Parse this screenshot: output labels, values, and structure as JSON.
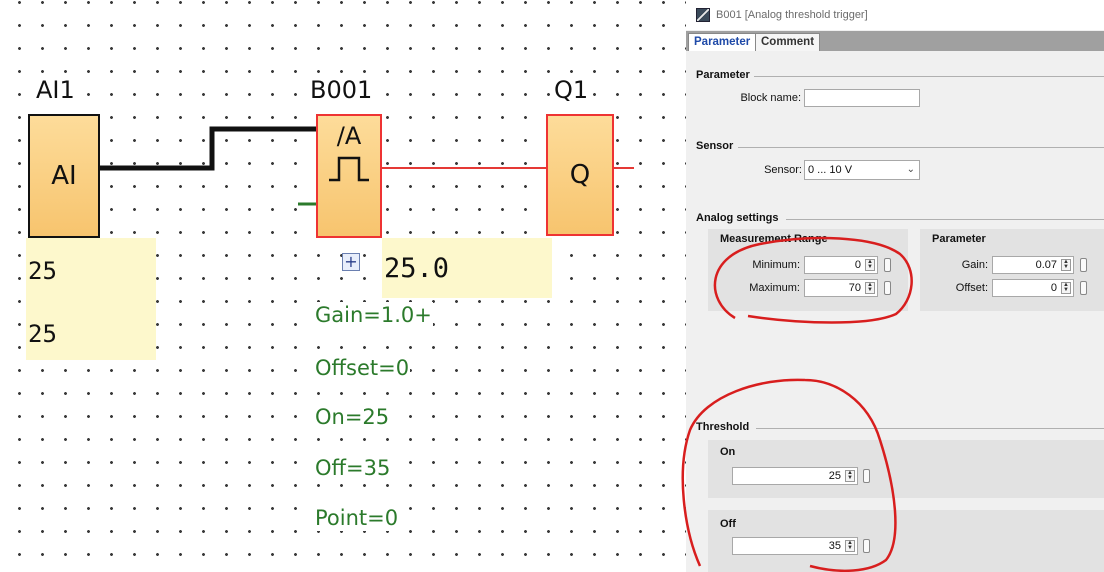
{
  "diagram": {
    "ai_block": {
      "title": "AI1",
      "label": "AI",
      "value1": "25",
      "value2": "25"
    },
    "b_block": {
      "title": "B001",
      "symbol": "/A",
      "expand": "+",
      "value": "25.0",
      "params": [
        "Gain=1.0+",
        "Offset=0",
        "On=25",
        "Off=35",
        "Point=0"
      ]
    },
    "q_block": {
      "title": "Q1",
      "label": "Q"
    },
    "colors": {
      "wire_input": "#111111",
      "wire_output": "#e53935",
      "param_text": "#2b7a2b",
      "block_fill": "#f7c46e"
    }
  },
  "dialog": {
    "title": "B001 [Analog threshold trigger]",
    "tabs": [
      "Parameter",
      "Comment"
    ],
    "parameter_section": {
      "title": "Parameter",
      "block_name_label": "Block name:",
      "block_name_value": ""
    },
    "sensor_section": {
      "title": "Sensor",
      "sensor_label": "Sensor:",
      "sensor_value": "0 ... 10 V"
    },
    "analog_settings": {
      "title": "Analog settings",
      "measurement_range": {
        "title": "Measurement Range",
        "min_label": "Minimum:",
        "min_value": "0",
        "max_label": "Maximum:",
        "max_value": "70"
      },
      "parameter": {
        "title": "Parameter",
        "gain_label": "Gain:",
        "gain_value": "0.07",
        "offset_label": "Offset:",
        "offset_value": "0"
      }
    },
    "threshold": {
      "title": "Threshold",
      "on_label": "On",
      "on_value": "25",
      "off_label": "Off",
      "off_value": "35"
    },
    "icons": {
      "spin": "spin-updown-icon",
      "reference": "reference-icon",
      "dropdown": "chevron-down-icon"
    }
  },
  "annotation_color": "#d81e1e"
}
